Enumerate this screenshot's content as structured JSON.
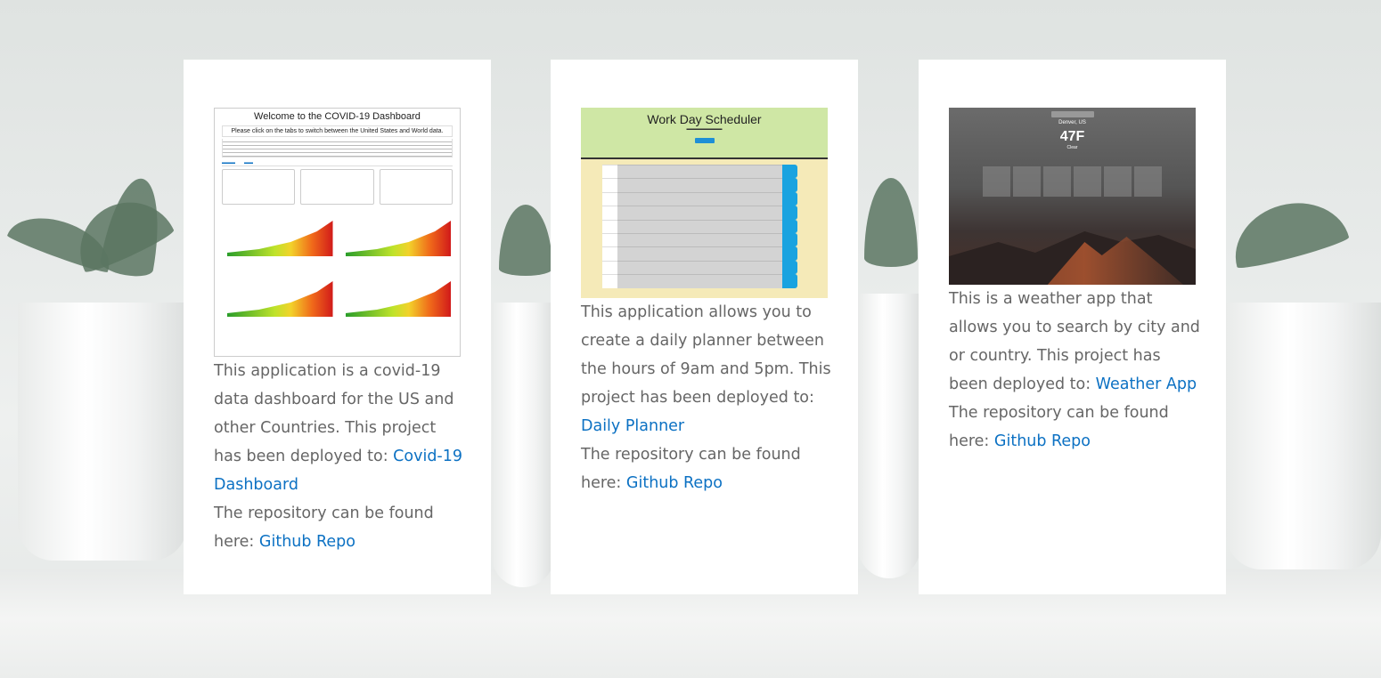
{
  "cards": [
    {
      "thumbnail": {
        "title": "Welcome to the COVID-19 Dashboard",
        "subtitle": "Please click on the tabs to switch between the United States and World data."
      },
      "desc_text": "This application is a covid-19 data dashboard for the US and other Countries. This project has been deployed to: ",
      "deploy_link": "Covid-19 Dashboard",
      "repo_text": "The repository can be found here: ",
      "repo_link": "Github Repo"
    },
    {
      "thumbnail": {
        "title": "Work Day Scheduler"
      },
      "desc_text": "This application allows you to create a daily planner between the hours of 9am and 5pm. This project has been deployed to: ",
      "deploy_link": "Daily Planner",
      "repo_text": "The repository can be found here: ",
      "repo_link": "Github Repo"
    },
    {
      "thumbnail": {
        "city": "Denver, US",
        "temp": "47F",
        "condition": "Clear"
      },
      "desc_text": "This is a weather app that allows you to search by city and or country. This project has been deployed to: ",
      "deploy_link": "Weather App",
      "repo_text": "The repository can be found here: ",
      "repo_link": "Github Repo"
    }
  ],
  "colors": {
    "link": "#0c71c3",
    "body_text": "#666666",
    "card_bg": "#ffffff"
  }
}
